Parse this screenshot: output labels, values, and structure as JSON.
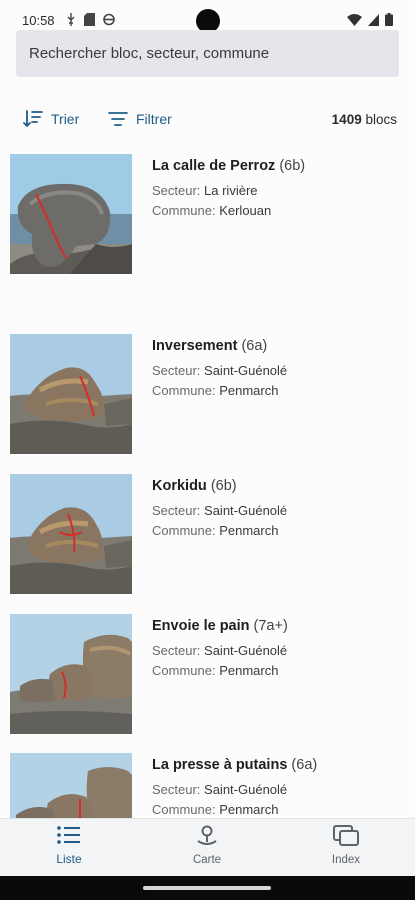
{
  "status_bar": {
    "time": "10:58",
    "icons_left": [
      "usb-debug-icon",
      "sd-card-icon",
      "shield-icon"
    ],
    "icons_right": [
      "wifi-icon",
      "signal-icon",
      "battery-icon"
    ]
  },
  "search": {
    "placeholder": "Rechercher bloc, secteur, commune",
    "value": ""
  },
  "toolbar": {
    "sort_label": "Trier",
    "filter_label": "Filtrer",
    "count_number": "1409",
    "count_unit": "blocs",
    "accent_color": "#1f5d86"
  },
  "labels": {
    "sector_prefix": "Secteur: ",
    "commune_prefix": "Commune: "
  },
  "blocs": [
    {
      "name": "La calle de Perroz",
      "grade": "(6b)",
      "sector": "La rivière",
      "commune": "Kerlouan"
    },
    {
      "name": "Inversement",
      "grade": "(6a)",
      "sector": "Saint-Guénolé",
      "commune": "Penmarch"
    },
    {
      "name": "Korkidu",
      "grade": "(6b)",
      "sector": "Saint-Guénolé",
      "commune": "Penmarch"
    },
    {
      "name": "Envoie le pain",
      "grade": "(7a+)",
      "sector": "Saint-Guénolé",
      "commune": "Penmarch"
    },
    {
      "name": "La presse à putains",
      "grade": "(6a)",
      "sector": "Saint-Guénolé",
      "commune": "Penmarch"
    }
  ],
  "bottom_nav": {
    "items": [
      {
        "label": "Liste",
        "icon": "list-icon",
        "active": true
      },
      {
        "label": "Carte",
        "icon": "map-pin-icon",
        "active": false
      },
      {
        "label": "Index",
        "icon": "index-stack-icon",
        "active": false
      }
    ]
  }
}
